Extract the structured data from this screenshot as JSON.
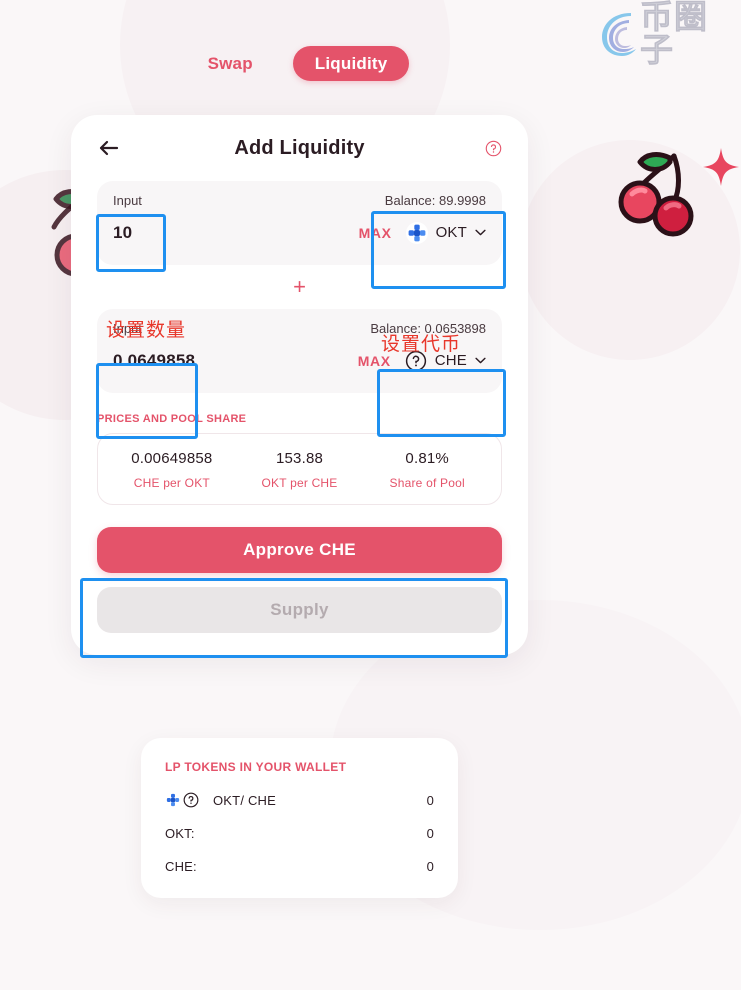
{
  "watermark": {
    "text": "币圈子",
    "icon": "spiral-logo-icon"
  },
  "tabs": [
    {
      "label": "Swap",
      "active": false
    },
    {
      "label": "Liquidity",
      "active": true
    }
  ],
  "card": {
    "title": "Add Liquidity",
    "back_icon": "back-arrow-icon",
    "help_icon": "help-circle-icon",
    "inputs": [
      {
        "label": "Input",
        "value": "10",
        "balance": "Balance: 89.9998",
        "max_label": "MAX",
        "token": "OKT",
        "token_icon": "okt-token-icon",
        "chevron_icon": "chevron-down-icon"
      },
      {
        "label": "Input",
        "value": "0.0649858",
        "balance": "Balance: 0.0653898",
        "max_label": "MAX",
        "token": "CHE",
        "token_icon": "unknown-token-icon",
        "chevron_icon": "chevron-down-icon"
      }
    ],
    "plus_sign": "+",
    "pool": {
      "section_title": "PRICES AND POOL SHARE",
      "columns": [
        {
          "value": "0.00649858",
          "caption": "CHE per OKT"
        },
        {
          "value": "153.88",
          "caption": "OKT per  CHE"
        },
        {
          "value": "0.81%",
          "caption": "Share of Pool"
        }
      ]
    },
    "approve_label": "Approve  CHE",
    "supply_label": "Supply"
  },
  "lp": {
    "title": "LP TOKENS IN YOUR WALLET",
    "rows": [
      {
        "name": "OKT/ CHE",
        "amount": "0",
        "has_icons": true
      },
      {
        "name": "OKT:",
        "amount": "0",
        "has_icons": false
      },
      {
        "name": "CHE:",
        "amount": "0",
        "has_icons": false
      }
    ]
  },
  "annotations": [
    {
      "text": "设置数量",
      "kind": "label"
    },
    {
      "text": "设置代币",
      "kind": "label"
    }
  ],
  "colors": {
    "accent": "#e4536a",
    "annotation_box": "#1e90f0",
    "annotation_text": "#e8372b",
    "background": "#faf7f8"
  }
}
